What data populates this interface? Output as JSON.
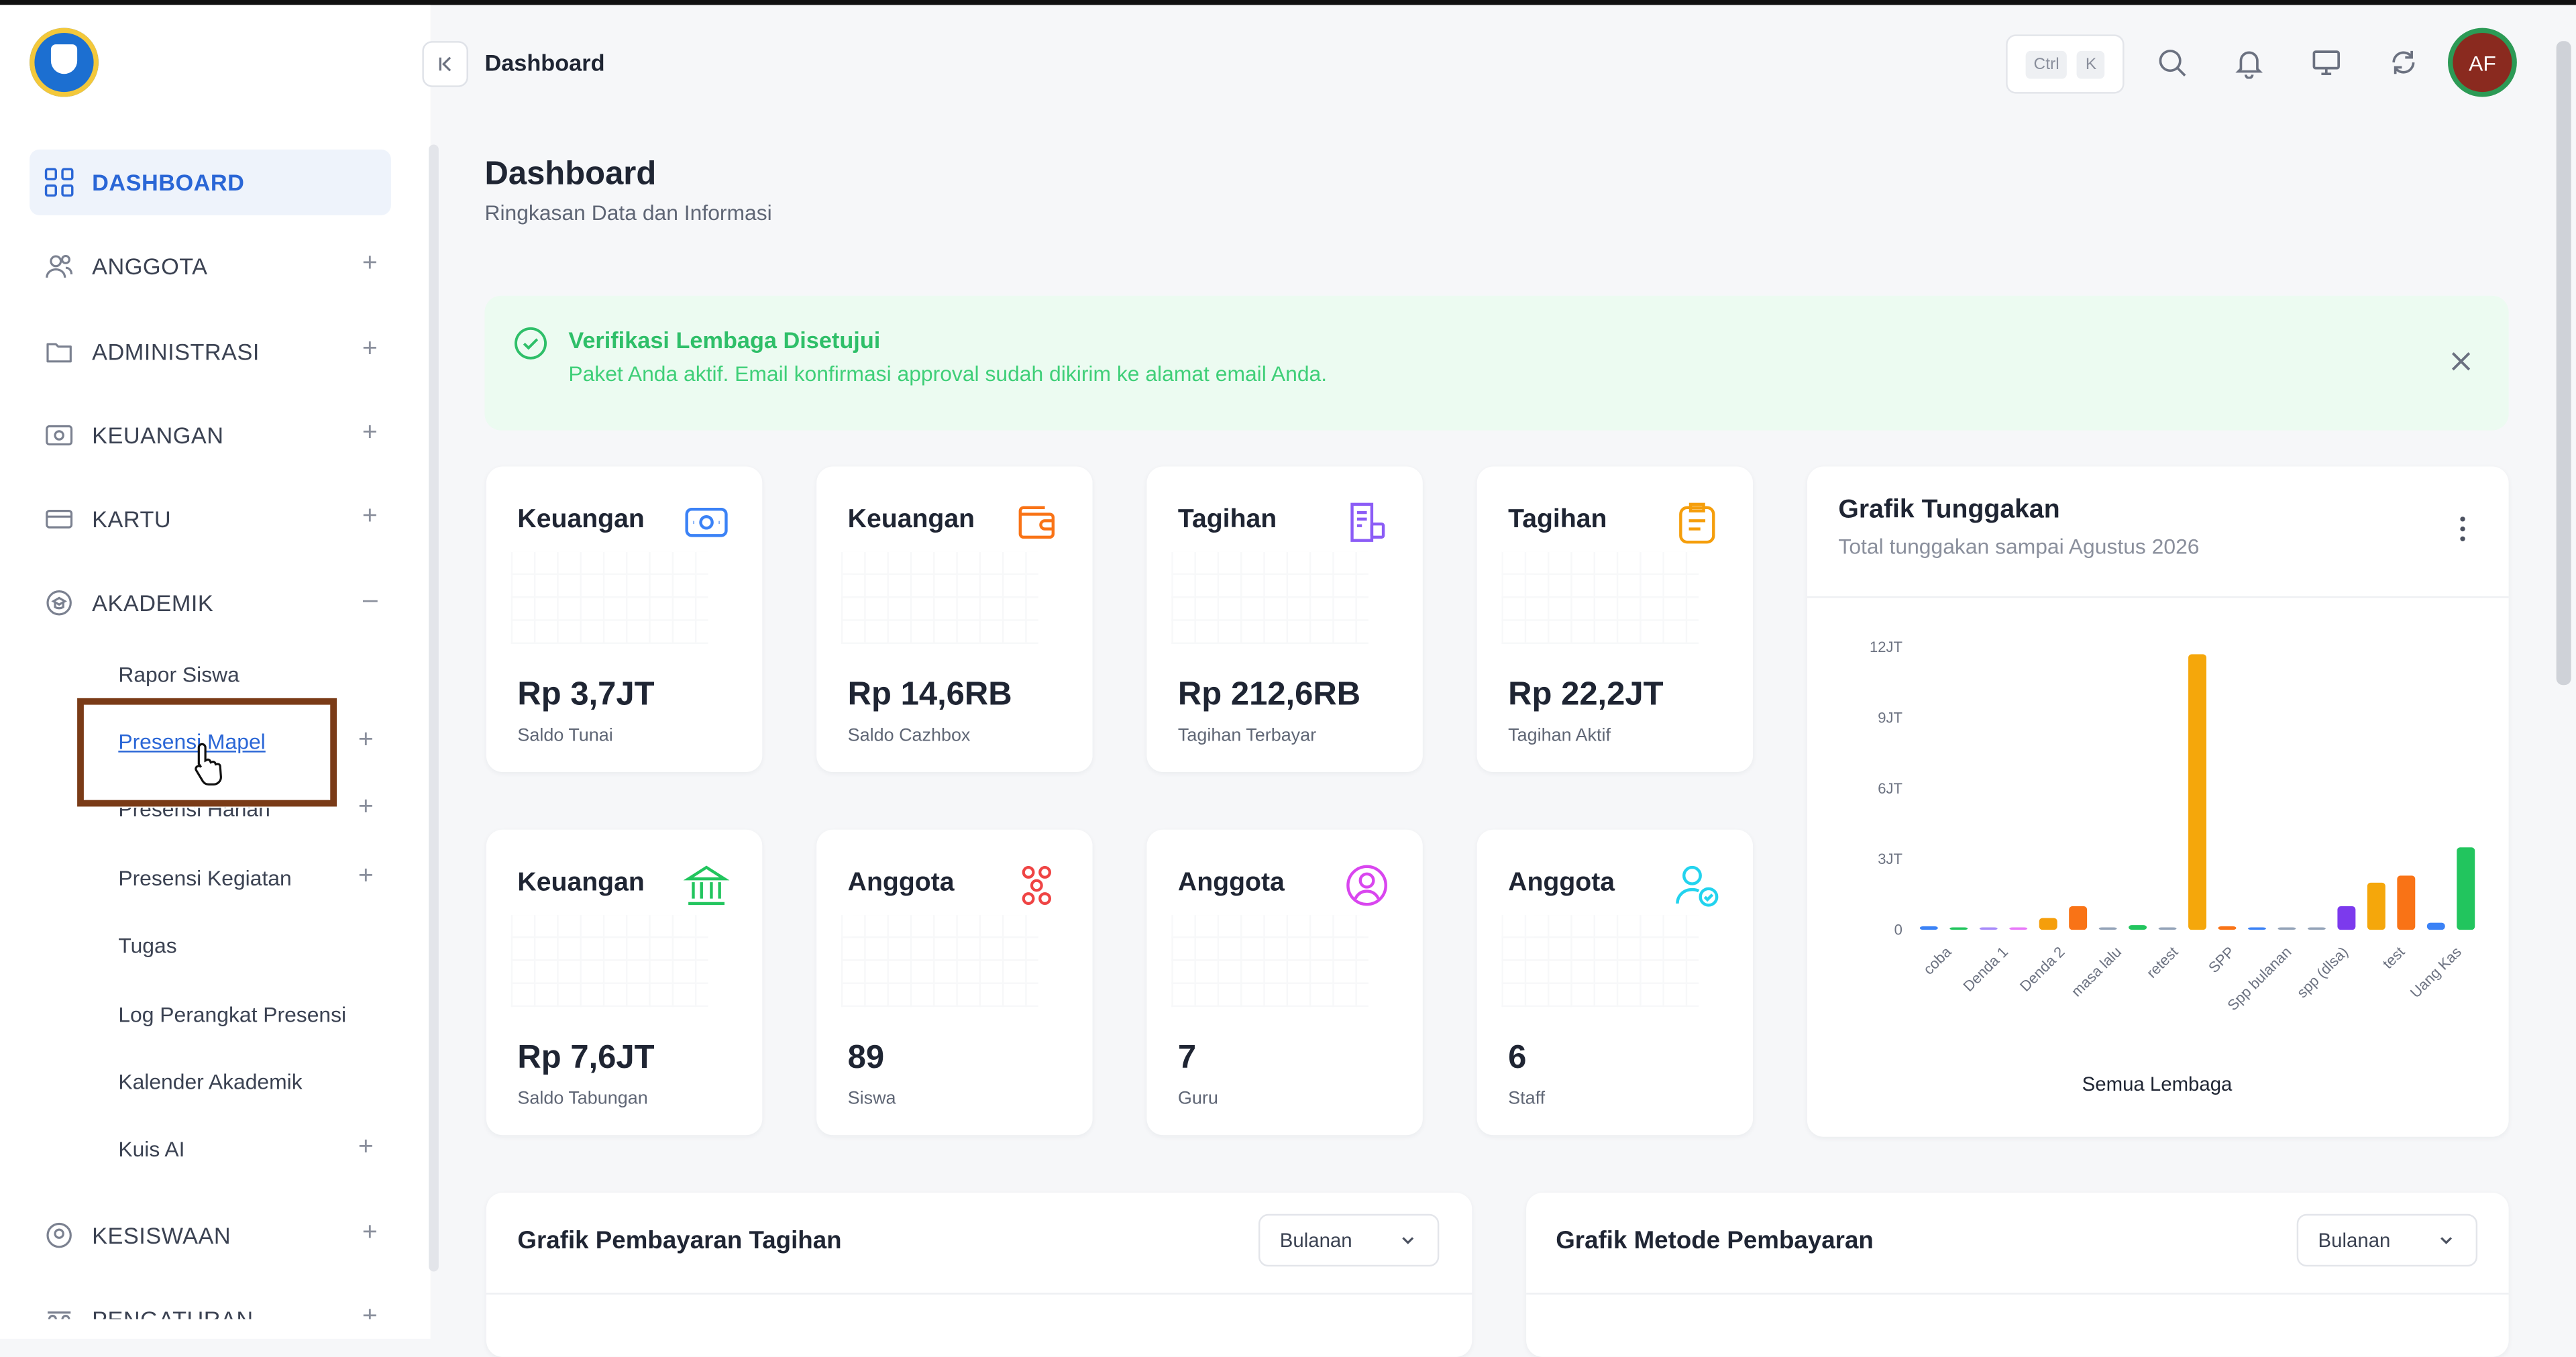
{
  "header": {
    "breadcrumb": "Dashboard",
    "shortcut_keys": [
      "Ctrl",
      "K"
    ],
    "avatar_initials": "AF"
  },
  "sidebar": {
    "items": [
      {
        "label": "DASHBOARD",
        "icon": "grid-icon",
        "active": true,
        "toggle": ""
      },
      {
        "label": "ANGGOTA",
        "icon": "users-icon",
        "toggle": "+"
      },
      {
        "label": "ADMINISTRASI",
        "icon": "folder-icon",
        "toggle": "+"
      },
      {
        "label": "KEUANGAN",
        "icon": "money-icon",
        "toggle": "+"
      },
      {
        "label": "KARTU",
        "icon": "card-icon",
        "toggle": "+"
      },
      {
        "label": "AKADEMIK",
        "icon": "academic-icon",
        "toggle": "–"
      },
      {
        "label": "KESISWAAN",
        "icon": "student-icon",
        "toggle": "+"
      },
      {
        "label": "PENGATURAN",
        "icon": "settings-icon",
        "toggle": "+"
      }
    ],
    "akademik_sub": [
      {
        "label": "Rapor Siswa",
        "toggle": ""
      },
      {
        "label": "Presensi Mapel",
        "toggle": "+"
      },
      {
        "label": "Presensi Harian",
        "toggle": "+"
      },
      {
        "label": "Presensi Kegiatan",
        "toggle": "+"
      },
      {
        "label": "Tugas",
        "toggle": ""
      },
      {
        "label": "Log Perangkat Presensi",
        "toggle": ""
      },
      {
        "label": "Kalender Akademik",
        "toggle": ""
      },
      {
        "label": "Kuis AI",
        "toggle": "+"
      }
    ]
  },
  "page": {
    "title": "Dashboard",
    "subtitle": "Ringkasan Data dan Informasi"
  },
  "alert": {
    "title": "Verifikasi Lembaga Disetujui",
    "message": "Paket Anda aktif. Email konfirmasi approval sudah dikirim ke alamat email Anda."
  },
  "cards": [
    {
      "title": "Keuangan",
      "value": "Rp 3,7JT",
      "label": "Saldo Tunai",
      "icon": "cash-icon",
      "color": "#3b82f6"
    },
    {
      "title": "Keuangan",
      "value": "Rp 14,6RB",
      "label": "Saldo Cazhbox",
      "icon": "wallet-icon",
      "color": "#f97316"
    },
    {
      "title": "Tagihan",
      "value": "Rp 212,6RB",
      "label": "Tagihan Terbayar",
      "icon": "invoice-icon",
      "color": "#8b5cf6"
    },
    {
      "title": "Tagihan",
      "value": "Rp 22,2JT",
      "label": "Tagihan Aktif",
      "icon": "clipboard-icon",
      "color": "#f59e0b"
    },
    {
      "title": "Keuangan",
      "value": "Rp 7,6JT",
      "label": "Saldo Tabungan",
      "icon": "bank-icon",
      "color": "#22c55e"
    },
    {
      "title": "Anggota",
      "value": "89",
      "label": "Siswa",
      "icon": "group-icon",
      "color": "#ef4444"
    },
    {
      "title": "Anggota",
      "value": "7",
      "label": "Guru",
      "icon": "user-circle-icon",
      "color": "#d946ef"
    },
    {
      "title": "Anggota",
      "value": "6",
      "label": "Staff",
      "icon": "user-check-icon",
      "color": "#22d3ee"
    }
  ],
  "chart_card": {
    "title": "Grafik Tunggakan",
    "subtitle": "Total tunggakan sampai Agustus 2026"
  },
  "chart_data": {
    "type": "bar",
    "title": "Grafik Tunggakan",
    "xlabel": "Semua Lembaga",
    "ylabel": "",
    "ylim": [
      0,
      12
    ],
    "y_ticks": [
      "0",
      "3JT",
      "6JT",
      "9JT",
      "12JT"
    ],
    "grid": false,
    "categories": [
      "coba",
      "Denda 1",
      "Denda 2",
      "masa lalu",
      "retest",
      "SPP",
      "Spp bulanan",
      "spp (dlsa)",
      "test",
      "Uang Kas"
    ],
    "series": [
      {
        "values": [
          0.15,
          0.1,
          0.1,
          1.0,
          0.2,
          11.7,
          0.15,
          1.0,
          2.3,
          3.5
        ]
      }
    ],
    "bars": [
      {
        "value": 0.15,
        "color": "#3b82f6"
      },
      {
        "value": 0.1,
        "color": "#22c55e"
      },
      {
        "value": 0.05,
        "color": "#a78bfa"
      },
      {
        "value": 0.05,
        "color": "#e879f9"
      },
      {
        "value": 0.5,
        "color": "#f59e0b"
      },
      {
        "value": 1.0,
        "color": "#f97316"
      },
      {
        "value": 0.02,
        "color": "#94a3b8"
      },
      {
        "value": 0.2,
        "color": "#22c55e"
      },
      {
        "value": 0.02,
        "color": "#94a3b8"
      },
      {
        "value": 11.7,
        "color": "#f5a70b"
      },
      {
        "value": 0.15,
        "color": "#f97316"
      },
      {
        "value": 0.1,
        "color": "#3b82f6"
      },
      {
        "value": 0.02,
        "color": "#94a3b8"
      },
      {
        "value": 0.02,
        "color": "#94a3b8"
      },
      {
        "value": 1.0,
        "color": "#7c3aed"
      },
      {
        "value": 2.0,
        "color": "#f5a70b"
      },
      {
        "value": 2.3,
        "color": "#f97316"
      },
      {
        "value": 0.3,
        "color": "#3b82f6"
      },
      {
        "value": 3.5,
        "color": "#22c55e"
      }
    ]
  },
  "bottom_cards": [
    {
      "title": "Grafik Pembayaran Tagihan",
      "select": "Bulanan"
    },
    {
      "title": "Grafik Metode Pembayaran",
      "select": "Bulanan"
    }
  ]
}
